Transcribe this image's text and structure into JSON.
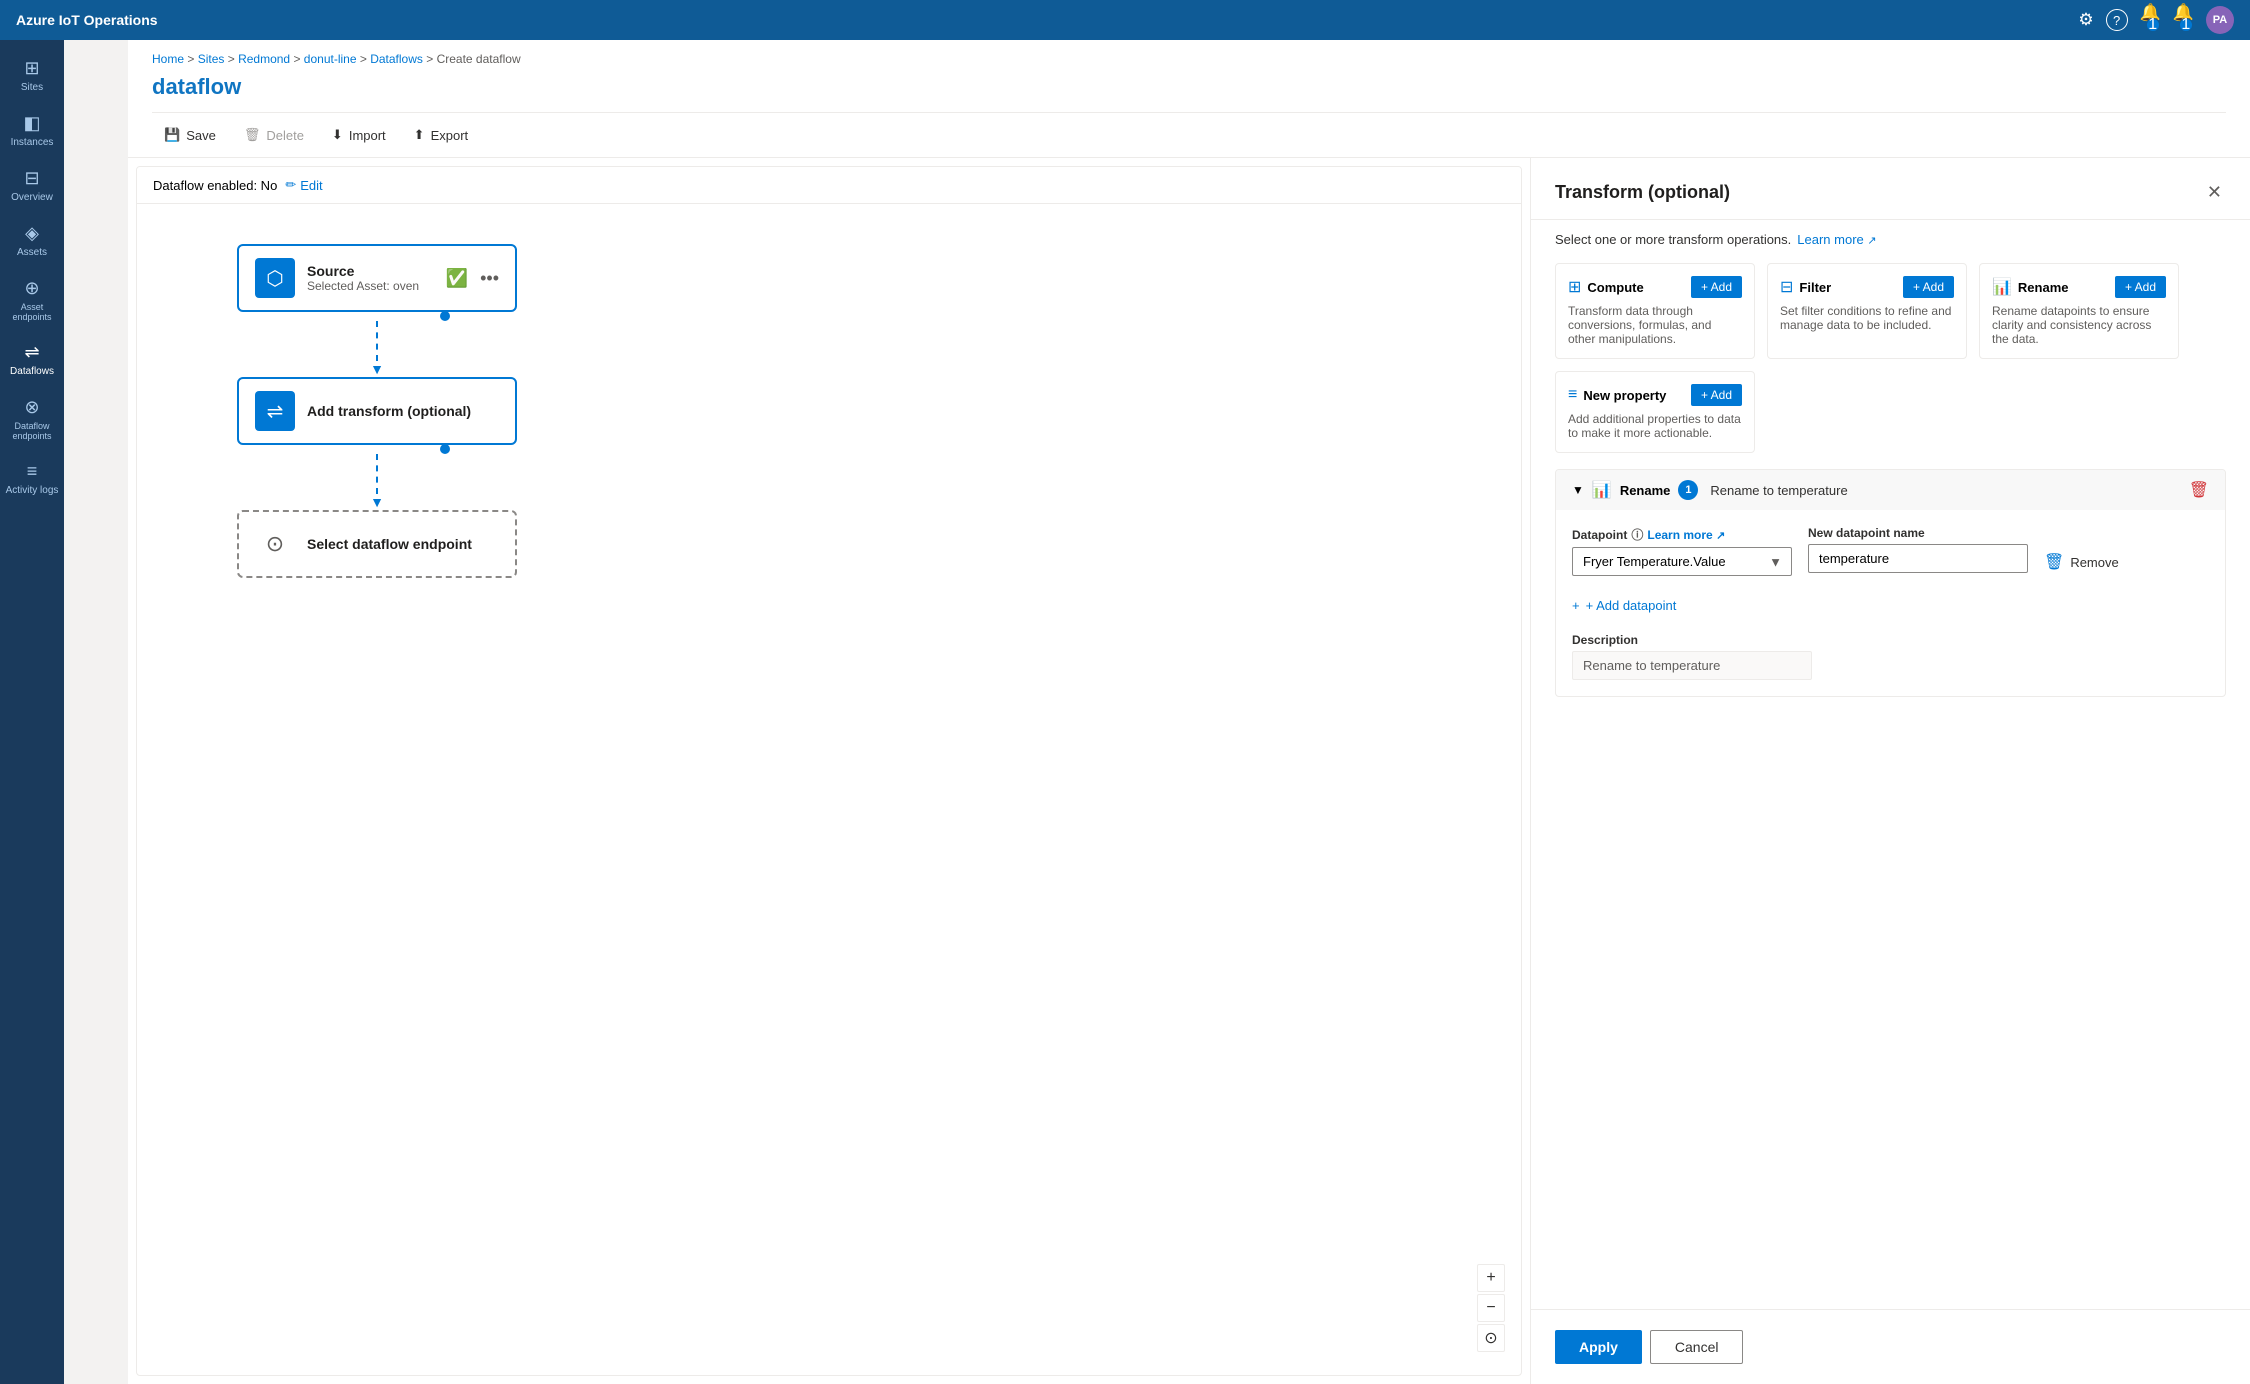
{
  "app": {
    "title": "Azure IoT Operations"
  },
  "nav": {
    "settings_icon": "⚙",
    "help_icon": "?",
    "notification1_icon": "🔔",
    "notification2_icon": "🔔",
    "notification1_badge": "1",
    "notification2_badge": "1",
    "avatar_text": "PA"
  },
  "sidebar": {
    "items": [
      {
        "id": "sites",
        "icon": "⊞",
        "label": "Sites"
      },
      {
        "id": "instances",
        "icon": "◧",
        "label": "Instances"
      },
      {
        "id": "overview",
        "icon": "⊟",
        "label": "Overview"
      },
      {
        "id": "assets",
        "icon": "◈",
        "label": "Assets"
      },
      {
        "id": "asset-endpoints",
        "icon": "⊕",
        "label": "Asset endpoints"
      },
      {
        "id": "dataflows",
        "icon": "⇌",
        "label": "Dataflows",
        "active": true
      },
      {
        "id": "dataflow-endpoints",
        "icon": "⊗",
        "label": "Dataflow endpoints"
      },
      {
        "id": "activity-logs",
        "icon": "≡",
        "label": "Activity logs"
      }
    ]
  },
  "breadcrumb": {
    "items": [
      "Home",
      "Sites",
      "Redmond",
      "donut-line",
      "Dataflows",
      "Create dataflow"
    ]
  },
  "page": {
    "title": "dataflow"
  },
  "toolbar": {
    "save_label": "Save",
    "delete_label": "Delete",
    "import_label": "Import",
    "export_label": "Export"
  },
  "dataflow_bar": {
    "enabled_label": "Dataflow enabled: No",
    "edit_label": "Edit"
  },
  "flow": {
    "source_node": {
      "title": "Source",
      "subtitle": "Selected Asset: oven"
    },
    "transform_node": {
      "title": "Add transform (optional)"
    },
    "endpoint_node": {
      "title": "Select dataflow endpoint"
    }
  },
  "canvas_controls": {
    "zoom_in": "+",
    "zoom_out": "−",
    "fit": "⊙"
  },
  "panel": {
    "title": "Transform (optional)",
    "subtitle_text": "Select one or more transform operations.",
    "learn_more_text": "Learn more",
    "cards": [
      {
        "id": "compute",
        "icon": "⊞",
        "title": "Compute",
        "desc": "Transform data through conversions, formulas, and other manipulations.",
        "add_label": "+ Add"
      },
      {
        "id": "filter",
        "icon": "⊟",
        "title": "Filter",
        "desc": "Set filter conditions to refine and manage data to be included.",
        "add_label": "+ Add"
      },
      {
        "id": "rename",
        "icon": "📊",
        "title": "Rename",
        "desc": "Rename datapoints to ensure clarity and consistency across the data.",
        "add_label": "+ Add"
      },
      {
        "id": "new-property",
        "icon": "≡",
        "title": "New property",
        "desc": "Add additional properties to data to make it more actionable.",
        "add_label": "+ Add"
      }
    ],
    "rename_section": {
      "icon": "📊",
      "title": "Rename",
      "badge": "1",
      "operation_label": "Rename to temperature",
      "datapoint_label": "Datapoint",
      "learn_more_label": "Learn more",
      "new_datapoint_label": "New datapoint name",
      "datapoint_value": "Fryer Temperature.Value",
      "new_name_value": "temperature",
      "remove_label": "Remove",
      "add_datapoint_label": "+ Add datapoint",
      "description_label": "Description",
      "description_value": "Rename to temperature"
    },
    "footer": {
      "apply_label": "Apply",
      "cancel_label": "Cancel"
    }
  }
}
